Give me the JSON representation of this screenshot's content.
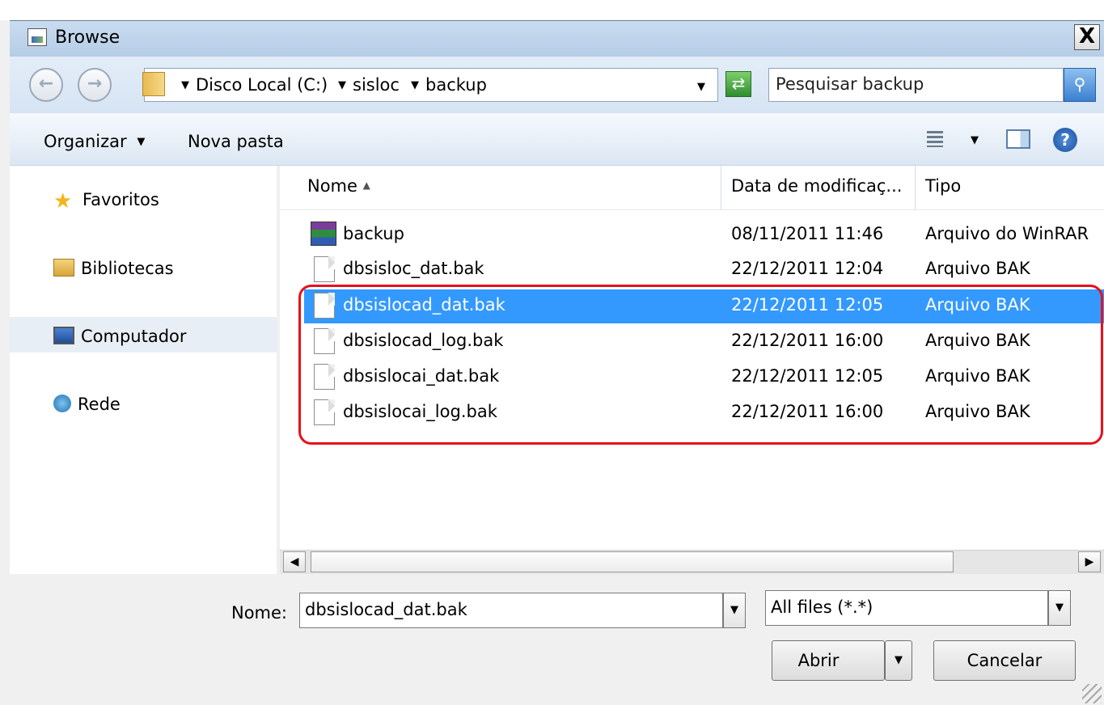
{
  "window": {
    "title": "Browse",
    "close_label": "X"
  },
  "navigation": {
    "back_label": "←",
    "forward_label": "→",
    "breadcrumbs": [
      "Disco Local (C:)",
      "sisloc",
      "backup"
    ],
    "search_placeholder": "Pesquisar backup"
  },
  "toolbar": {
    "organize_label": "Organizar",
    "new_folder_label": "Nova pasta"
  },
  "sidebar": {
    "items": [
      {
        "label": "Favoritos",
        "icon": "star-icon"
      },
      {
        "label": "Bibliotecas",
        "icon": "libraries-icon"
      },
      {
        "label": "Computador",
        "icon": "computer-icon"
      },
      {
        "label": "Rede",
        "icon": "network-icon"
      }
    ],
    "selected": "Computador"
  },
  "file_list": {
    "columns": [
      "Nome",
      "Data de modificaç...",
      "Tipo"
    ],
    "sort_column": "Nome",
    "rows": [
      {
        "name": "backup",
        "date": "08/11/2011 11:46",
        "type": "Arquivo do WinRAR",
        "icon": "winrar-icon"
      },
      {
        "name": "dbsisloc_dat.bak",
        "date": "22/12/2011 12:04",
        "type": "Arquivo BAK",
        "icon": "file-icon"
      },
      {
        "name": "dbsislocad_dat.bak",
        "date": "22/12/2011 12:05",
        "type": "Arquivo BAK",
        "icon": "file-icon"
      },
      {
        "name": "dbsislocad_log.bak",
        "date": "22/12/2011 16:00",
        "type": "Arquivo BAK",
        "icon": "file-icon"
      },
      {
        "name": "dbsislocai_dat.bak",
        "date": "22/12/2011 12:05",
        "type": "Arquivo BAK",
        "icon": "file-icon"
      },
      {
        "name": "dbsislocai_log.bak",
        "date": "22/12/2011 16:00",
        "type": "Arquivo BAK",
        "icon": "file-icon"
      }
    ],
    "selected_index": 2
  },
  "footer": {
    "filename_label": "Nome:",
    "filename_value": "dbsislocad_dat.bak",
    "filter_value": "All files (*.*)",
    "open_label": "Abrir",
    "cancel_label": "Cancelar"
  },
  "colors": {
    "selection": "#3399ff",
    "highlight_outline": "#e8101c"
  }
}
